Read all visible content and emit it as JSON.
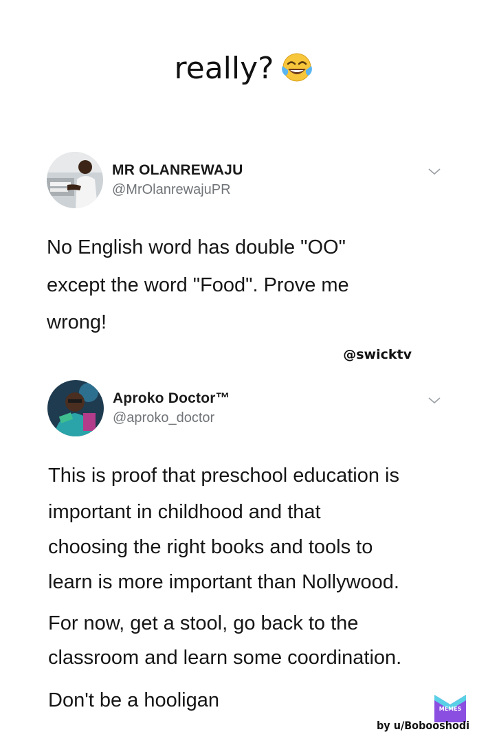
{
  "caption": {
    "text": "really?",
    "emoji": "face-with-tears-of-joy"
  },
  "tweet1": {
    "name": "MR OLANREWAJU",
    "handle": "@MrOlanrewajuPR",
    "lines": [
      "No English word has double \"OO\"",
      "except the word \"Food\".  Prove me",
      "wrong!"
    ]
  },
  "watermark": "@swicktv",
  "tweet2": {
    "name": "Aproko Doctor™",
    "handle": "@aproko_doctor",
    "lines": [
      "This is proof that preschool education is",
      "important in childhood and that",
      "choosing the right books and tools to",
      "learn is more important than Nollywood.",
      "For now, get a stool, go back to the",
      "classroom and learn some coordination.",
      "Don't be a hooligan"
    ]
  },
  "footer": {
    "logo_text": "MEMES",
    "byline": "by u/Bobooshodi"
  },
  "colors": {
    "handle": "#707478",
    "logo": "#8a4fe0"
  }
}
